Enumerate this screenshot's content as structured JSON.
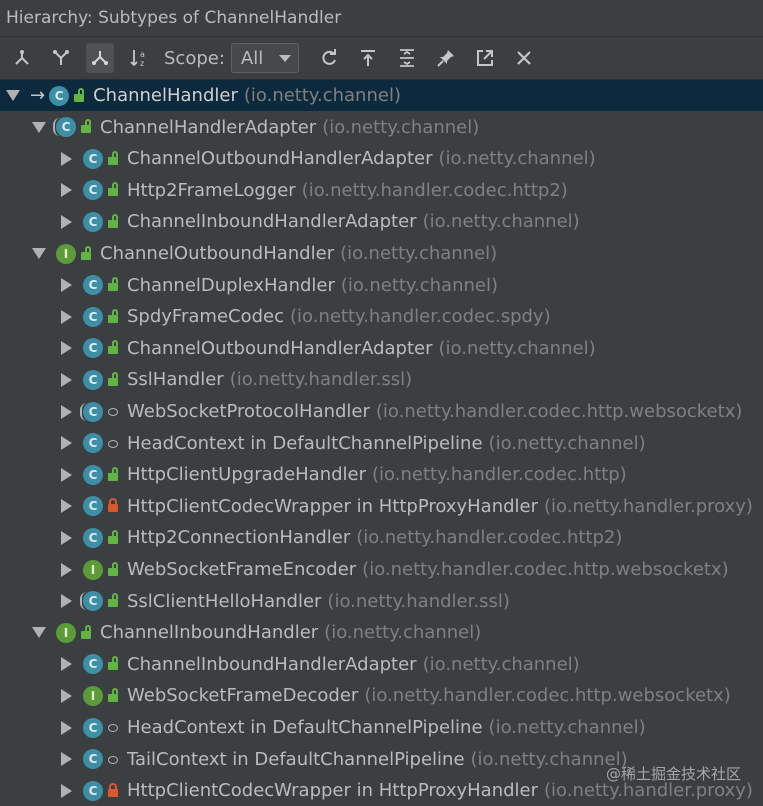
{
  "window": {
    "title": "Hierarchy:  Subtypes of ChannelHandler"
  },
  "toolbar": {
    "buttons": [
      {
        "icon": "type-hierarchy-icon",
        "active": false
      },
      {
        "icon": "supertypes-hierarchy-icon",
        "active": false
      },
      {
        "icon": "subtypes-hierarchy-icon",
        "active": true
      },
      {
        "icon": "sort-alphabetically-icon",
        "active": false
      }
    ],
    "scope_label": "Scope:",
    "scope_value": "All",
    "actions": [
      "refresh-icon",
      "export-icon",
      "expand-all-icon",
      "pin-icon",
      "open-in-window-icon",
      "close-icon"
    ]
  },
  "tree": {
    "rows": [
      {
        "indent": 0,
        "expanded": true,
        "kind": "c",
        "abstract": false,
        "root": true,
        "vis": "unlock",
        "name": "ChannelHandler",
        "pkg": "(io.netty.channel)"
      },
      {
        "indent": 1,
        "expanded": true,
        "kind": "c",
        "abstract": true,
        "vis": "unlock",
        "name": "ChannelHandlerAdapter",
        "pkg": "(io.netty.channel)"
      },
      {
        "indent": 2,
        "expanded": false,
        "kind": "c",
        "abstract": false,
        "vis": "unlock",
        "name": "ChannelOutboundHandlerAdapter",
        "pkg": "(io.netty.channel)"
      },
      {
        "indent": 2,
        "expanded": false,
        "kind": "c",
        "abstract": false,
        "vis": "unlock",
        "name": "Http2FrameLogger",
        "pkg": "(io.netty.handler.codec.http2)"
      },
      {
        "indent": 2,
        "expanded": false,
        "kind": "c",
        "abstract": false,
        "vis": "unlock",
        "name": "ChannelInboundHandlerAdapter",
        "pkg": "(io.netty.channel)"
      },
      {
        "indent": 1,
        "expanded": true,
        "kind": "i",
        "abstract": false,
        "vis": "unlock",
        "name": "ChannelOutboundHandler",
        "pkg": "(io.netty.channel)"
      },
      {
        "indent": 2,
        "expanded": false,
        "kind": "c",
        "abstract": false,
        "vis": "unlock",
        "name": "ChannelDuplexHandler",
        "pkg": "(io.netty.channel)"
      },
      {
        "indent": 2,
        "expanded": false,
        "kind": "c",
        "abstract": false,
        "vis": "unlock",
        "name": "SpdyFrameCodec",
        "pkg": "(io.netty.handler.codec.spdy)"
      },
      {
        "indent": 2,
        "expanded": false,
        "kind": "c",
        "abstract": false,
        "vis": "unlock",
        "name": "ChannelOutboundHandlerAdapter",
        "pkg": "(io.netty.channel)"
      },
      {
        "indent": 2,
        "expanded": false,
        "kind": "c",
        "abstract": false,
        "vis": "unlock",
        "name": "SslHandler",
        "pkg": "(io.netty.handler.ssl)"
      },
      {
        "indent": 2,
        "expanded": false,
        "kind": "c",
        "abstract": true,
        "vis": "pkg",
        "name": "WebSocketProtocolHandler",
        "pkg": "(io.netty.handler.codec.http.websocketx)"
      },
      {
        "indent": 2,
        "expanded": false,
        "kind": "c",
        "abstract": false,
        "vis": "pkg",
        "name": "HeadContext in DefaultChannelPipeline",
        "pkg": "(io.netty.channel)"
      },
      {
        "indent": 2,
        "expanded": false,
        "kind": "c",
        "abstract": false,
        "vis": "unlock",
        "name": "HttpClientUpgradeHandler",
        "pkg": "(io.netty.handler.codec.http)"
      },
      {
        "indent": 2,
        "expanded": false,
        "kind": "c",
        "abstract": false,
        "vis": "lock",
        "name": "HttpClientCodecWrapper in HttpProxyHandler",
        "pkg": "(io.netty.handler.proxy)"
      },
      {
        "indent": 2,
        "expanded": false,
        "kind": "c",
        "abstract": false,
        "vis": "unlock",
        "name": "Http2ConnectionHandler",
        "pkg": "(io.netty.handler.codec.http2)"
      },
      {
        "indent": 2,
        "expanded": false,
        "kind": "i",
        "abstract": false,
        "vis": "unlock",
        "name": "WebSocketFrameEncoder",
        "pkg": "(io.netty.handler.codec.http.websocketx)"
      },
      {
        "indent": 2,
        "expanded": false,
        "kind": "c",
        "abstract": true,
        "vis": "unlock",
        "name": "SslClientHelloHandler",
        "pkg": "(io.netty.handler.ssl)"
      },
      {
        "indent": 1,
        "expanded": true,
        "kind": "i",
        "abstract": false,
        "vis": "unlock",
        "name": "ChannelInboundHandler",
        "pkg": "(io.netty.channel)"
      },
      {
        "indent": 2,
        "expanded": false,
        "kind": "c",
        "abstract": false,
        "vis": "unlock",
        "name": "ChannelInboundHandlerAdapter",
        "pkg": "(io.netty.channel)"
      },
      {
        "indent": 2,
        "expanded": false,
        "kind": "i",
        "abstract": false,
        "vis": "unlock",
        "name": "WebSocketFrameDecoder",
        "pkg": "(io.netty.handler.codec.http.websocketx)"
      },
      {
        "indent": 2,
        "expanded": false,
        "kind": "c",
        "abstract": false,
        "vis": "pkg",
        "name": "HeadContext in DefaultChannelPipeline",
        "pkg": "(io.netty.channel)"
      },
      {
        "indent": 2,
        "expanded": false,
        "kind": "c",
        "abstract": false,
        "vis": "pkg",
        "name": "TailContext in DefaultChannelPipeline",
        "pkg": "(io.netty.channel)"
      },
      {
        "indent": 2,
        "expanded": false,
        "kind": "c",
        "abstract": false,
        "vis": "lock",
        "name": "HttpClientCodecWrapper in HttpProxyHandler",
        "pkg": "(io.netty.handler.proxy)"
      }
    ]
  },
  "watermark": "@稀土掘金技术社区"
}
